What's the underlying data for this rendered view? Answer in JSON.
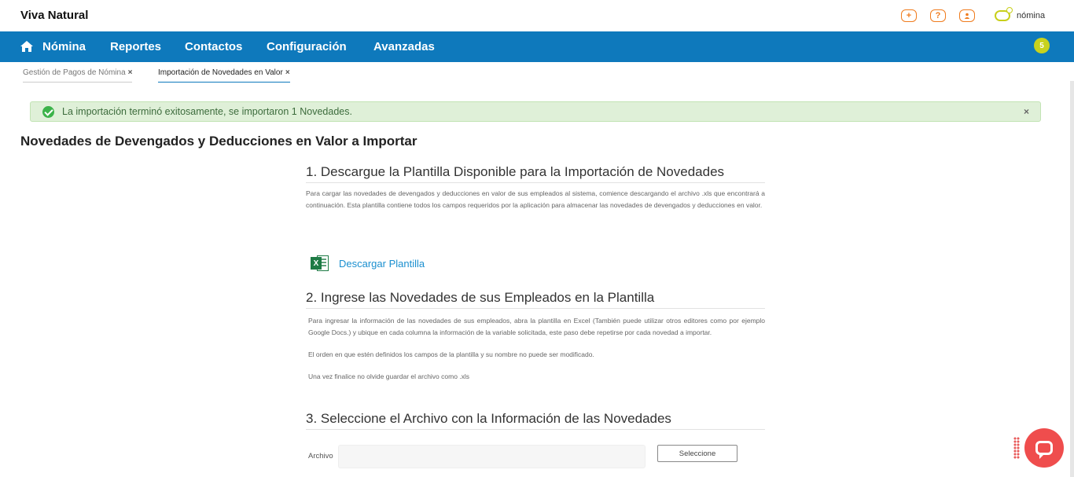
{
  "header": {
    "company": "Viva Natural",
    "brand_name": "nómina",
    "icons": [
      {
        "name": "add-icon",
        "glyph": "+"
      },
      {
        "name": "help-icon",
        "glyph": "?"
      },
      {
        "name": "user-icon",
        "glyph": "●"
      }
    ],
    "accent_color": "#f07c1e"
  },
  "nav": {
    "items": [
      "Nómina",
      "Reportes",
      "Contactos",
      "Configuración",
      "Avanzadas"
    ],
    "notification_count": "5",
    "background": "#0e79bc"
  },
  "tabs": [
    {
      "label": "Gestión de Pagos de Nómina",
      "close": "×",
      "active": false
    },
    {
      "label": "Importación de Novedades en Valor",
      "close": "×",
      "active": true
    }
  ],
  "alert": {
    "text": "La importación terminó exitosamente, se importaron 1 Novedades.",
    "close": "×"
  },
  "page": {
    "title": "Novedades de Devengados y Deducciones en Valor a Importar"
  },
  "steps": {
    "step1": {
      "title": "1. Descargue la Plantilla Disponible para la Importación de Novedades",
      "text": "Para cargar las novedades de devengados y deducciones en valor de sus empleados al sistema, comience descargando el archivo .xls que encontrará a continuación. Esta plantilla contiene todos los campos requeridos por la aplicación para almacenar las novedades de devengados y deducciones en valor.",
      "link": "Descargar Plantilla"
    },
    "step2": {
      "title": "2. Ingrese las Novedades de sus Empleados en la Plantilla",
      "text1": "Para ingresar la información de las novedades de sus empleados, abra la plantilla en Excel (También puede utilizar otros editores como por ejemplo Google Docs.) y ubique en cada columna la información de la variable solicitada, este paso debe repetirse por cada novedad a importar.",
      "text2": "El orden en que estén definidos los campos de la plantilla y su nombre no puede ser modificado.",
      "text3": "Una vez finalice no olvide guardar el archivo como .xls"
    },
    "step3": {
      "title": "3. Seleccione el Archivo con la Información de las Novedades",
      "file_label": "Archivo",
      "file_value": "",
      "button": "Seleccione"
    }
  }
}
